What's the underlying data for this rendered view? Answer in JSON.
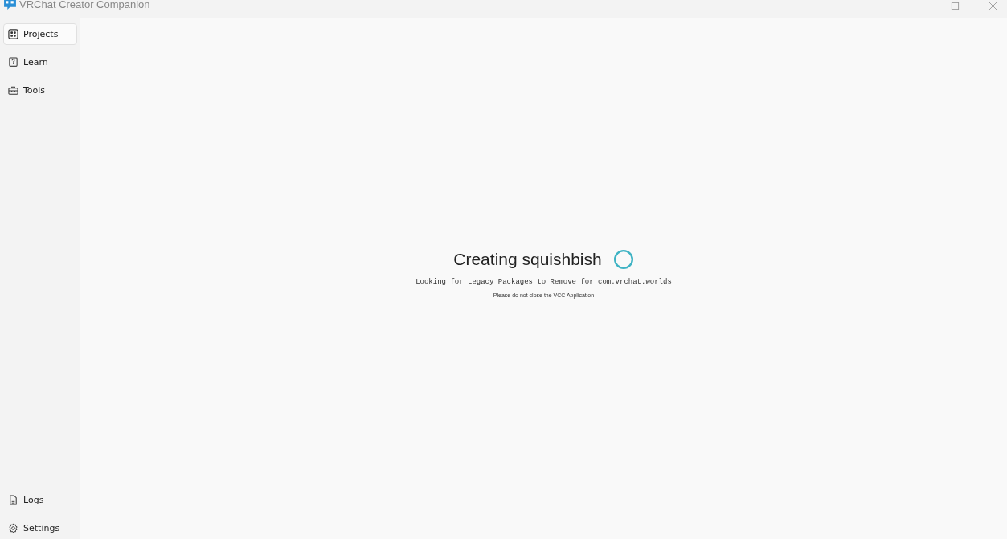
{
  "window": {
    "title": "VRChat Creator Companion"
  },
  "sidebar": {
    "items": [
      {
        "label": "Projects",
        "selected": true
      },
      {
        "label": "Learn",
        "selected": false
      },
      {
        "label": "Tools",
        "selected": false
      }
    ],
    "bottom_items": [
      {
        "label": "Logs",
        "selected": false
      },
      {
        "label": "Settings",
        "selected": false
      }
    ]
  },
  "progress": {
    "title": "Creating squishbish",
    "status": "Looking for Legacy Packages to Remove for com.vrchat.worlds",
    "note": "Please do not close the VCC Application"
  }
}
